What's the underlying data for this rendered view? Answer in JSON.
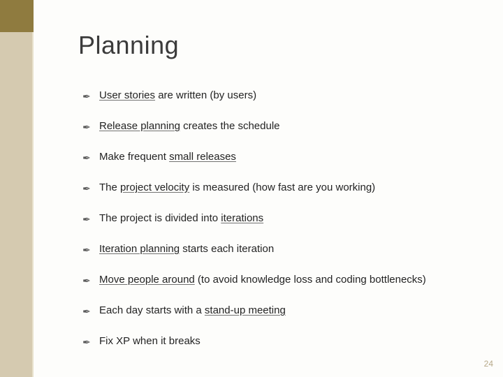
{
  "title": "Planning",
  "bullet_glyph": "✒",
  "items": [
    {
      "segments": [
        {
          "k": "u",
          "t": "User stories"
        },
        {
          "k": "n",
          "t": " are written (by users)"
        }
      ]
    },
    {
      "segments": [
        {
          "k": "u",
          "t": "Release planning"
        },
        {
          "k": "n",
          "t": " creates the schedule"
        }
      ]
    },
    {
      "segments": [
        {
          "k": "n",
          "t": "Make frequent "
        },
        {
          "k": "u",
          "t": "small releases"
        }
      ]
    },
    {
      "segments": [
        {
          "k": "n",
          "t": "The "
        },
        {
          "k": "u",
          "t": "project velocity"
        },
        {
          "k": "n",
          "t": " is measured (how fast are you working)"
        }
      ]
    },
    {
      "segments": [
        {
          "k": "n",
          "t": "The project is divided into "
        },
        {
          "k": "u",
          "t": "iterations"
        }
      ]
    },
    {
      "segments": [
        {
          "k": "u",
          "t": "Iteration planning"
        },
        {
          "k": "n",
          "t": " starts each iteration"
        }
      ]
    },
    {
      "segments": [
        {
          "k": "u",
          "t": "Move people around"
        },
        {
          "k": "n",
          "t": " (to avoid knowledge loss and coding bottlenecks)"
        }
      ]
    },
    {
      "segments": [
        {
          "k": "n",
          "t": "Each day starts with a "
        },
        {
          "k": "u",
          "t": "stand-up meeting"
        }
      ]
    },
    {
      "segments": [
        {
          "k": "n",
          "t": "Fix XP when it breaks"
        }
      ]
    }
  ],
  "page_number": "24"
}
